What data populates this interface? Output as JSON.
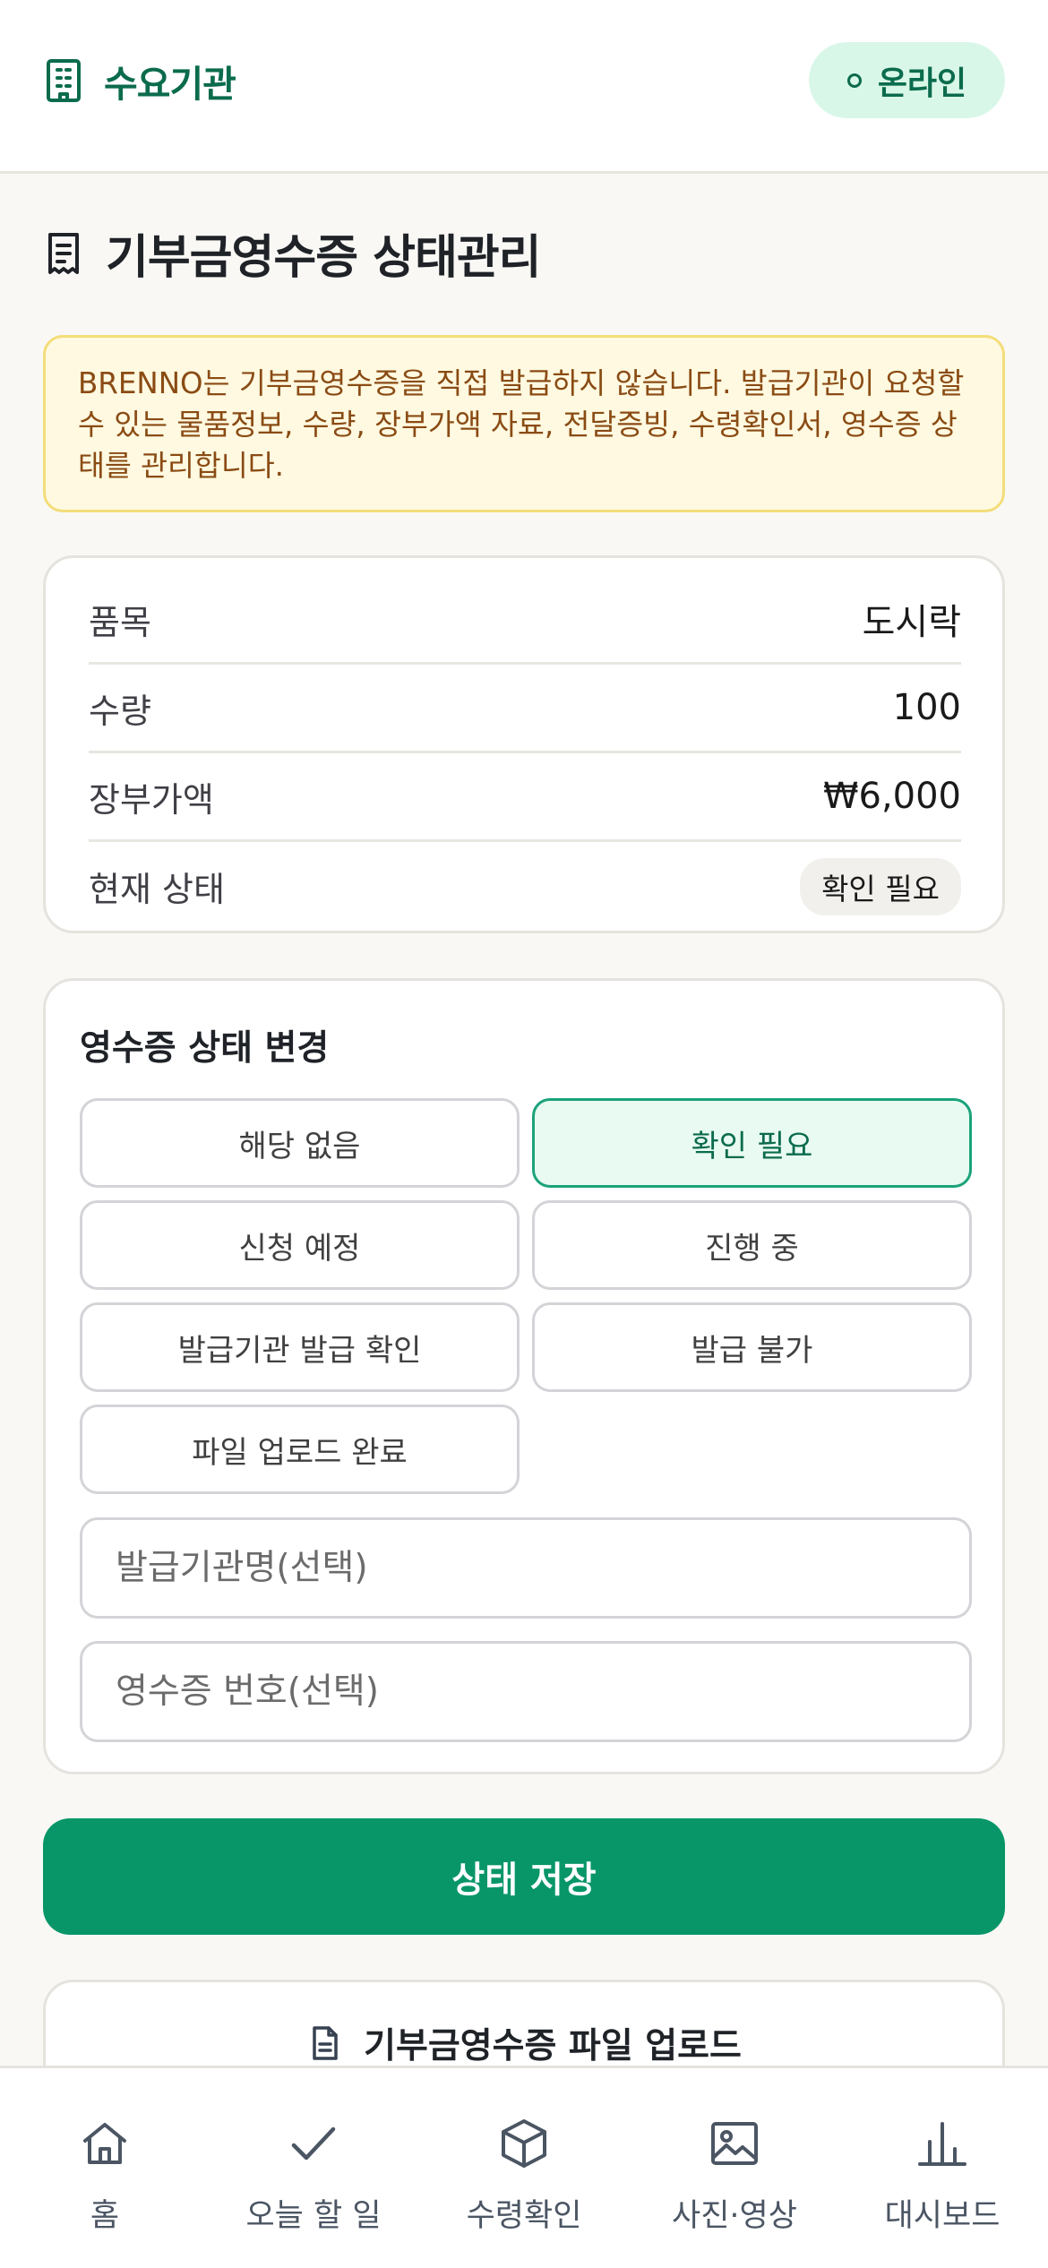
{
  "header": {
    "org_name": "수요기관",
    "online_label": "온라인"
  },
  "page_title": "기부금영수증 상태관리",
  "notice_text": "BRENNO는 기부금영수증을 직접 발급하지 않습니다. 발급기관이 요청할 수 있는 물품정보, 수량, 장부가액 자료, 전달증빙, 수령확인서, 영수증 상태를 관리합니다.",
  "item_info": {
    "rows": [
      {
        "label": "품목",
        "value": "도시락"
      },
      {
        "label": "수량",
        "value": "100"
      },
      {
        "label": "장부가액",
        "value": "₩6,000"
      }
    ],
    "status_label": "현재 상태",
    "status_value": "확인 필요"
  },
  "status_change": {
    "title": "영수증 상태 변경",
    "options": [
      {
        "label": "해당 없음",
        "selected": false
      },
      {
        "label": "확인 필요",
        "selected": true
      },
      {
        "label": "신청 예정",
        "selected": false
      },
      {
        "label": "진행 중",
        "selected": false
      },
      {
        "label": "발급기관 발급 확인",
        "selected": false
      },
      {
        "label": "발급 불가",
        "selected": false
      },
      {
        "label": "파일 업로드 완료",
        "selected": false
      }
    ],
    "issuer_placeholder": "발급기관명(선택)",
    "receipt_no_placeholder": "영수증 번호(선택)"
  },
  "save_label": "상태 저장",
  "upload": {
    "title": "기부금영수증 파일 업로드"
  },
  "bottom_nav": [
    {
      "label": "홈",
      "icon": "home-icon"
    },
    {
      "label": "오늘 할 일",
      "icon": "check-icon"
    },
    {
      "label": "수령확인",
      "icon": "box-icon"
    },
    {
      "label": "사진·영상",
      "icon": "image-icon"
    },
    {
      "label": "대시보드",
      "icon": "chart-icon"
    }
  ],
  "colors": {
    "brand_green": "#089669",
    "dark_green": "#0b6b4d",
    "notice_bg": "#fef9e0",
    "notice_text": "#8a4b14"
  }
}
